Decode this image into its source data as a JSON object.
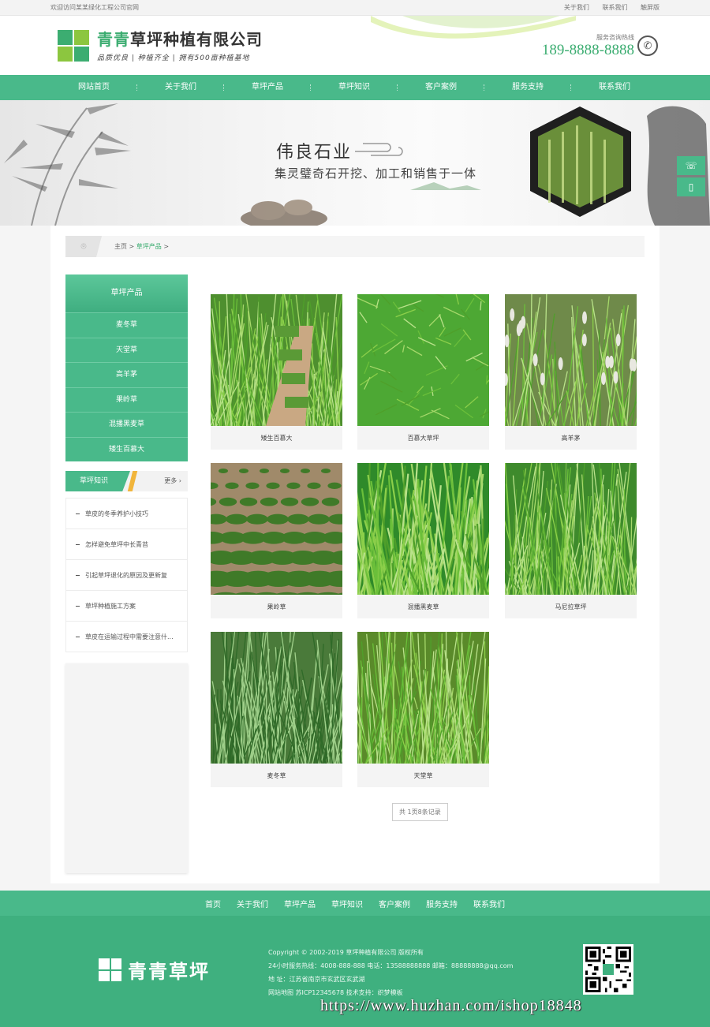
{
  "topbar": {
    "welcome": "欢迎访问某某绿化工程公司官网",
    "links": [
      "关于我们",
      "联系我们",
      "触屏版"
    ]
  },
  "header": {
    "company_name_green": "青青",
    "company_name_rest": "草坪种植有限公司",
    "slogan": "品质优良 | 种植齐全 | 拥有500亩种植基地",
    "hotline_label": "服务咨询热线",
    "hotline_number": "189-8888-8888",
    "logo_colors": [
      "#3cad71",
      "#8cc63f",
      "#8cc63f",
      "#3cad71"
    ]
  },
  "nav": {
    "items": [
      "网站首页",
      "关于我们",
      "草坪产品",
      "草坪知识",
      "客户案例",
      "服务支持",
      "联系我们"
    ]
  },
  "banner": {
    "title": "伟良石业",
    "subtitle": "集灵璧奇石开挖、加工和销售于一体"
  },
  "float_buttons": [
    "headset-icon",
    "mobile-icon"
  ],
  "breadcrumb": {
    "home": "主页",
    "sep": " > ",
    "current": "草坪产品",
    "tail": " >"
  },
  "sidebar": {
    "category_title": "草坪产品",
    "categories": [
      "麦冬草",
      "天堂草",
      "高羊茅",
      "果岭草",
      "混播黑麦草",
      "矮生百慕大"
    ],
    "knowledge_title": "草坪知识",
    "knowledge_more": "更多",
    "knowledge_items": [
      "草皮的冬季养护小技巧",
      "怎样避免草坪中长青苔",
      "引起草坪退化的原因及更新复",
      "草坪种植施工方案",
      "草皮在运输过程中需要注意什..."
    ]
  },
  "products": [
    {
      "name": "矮生百慕大",
      "style": "roll"
    },
    {
      "name": "百慕大草坪",
      "style": "lawn"
    },
    {
      "name": "高羊茅",
      "style": "tall"
    },
    {
      "name": "果岭草",
      "style": "rows"
    },
    {
      "name": "混播黑麦草",
      "style": "blades"
    },
    {
      "name": "马尼拉草坪",
      "style": "dense"
    },
    {
      "name": "麦冬草",
      "style": "mondo"
    },
    {
      "name": "天堂草",
      "style": "fine"
    }
  ],
  "pager": {
    "text": "共 1页8条记录"
  },
  "footer_nav": [
    "首页",
    "关于我们",
    "草坪产品",
    "草坪知识",
    "客户案例",
    "服务支持",
    "联系我们"
  ],
  "footer": {
    "logo_name": "青青草坪",
    "copyright": "Copyright © 2002-2019 草坪种植有限公司 版权所有",
    "contact": "24小时服务热线：4008-888-888 电话：13588888888 邮箱：88888888@qq.com",
    "address": "地 址：江苏省南京市玄武区玄武湖",
    "icp": "网站地图 苏ICP12345678 技术支持：织梦模板"
  },
  "watermark": "https://www.huzhan.com/ishop18848"
}
